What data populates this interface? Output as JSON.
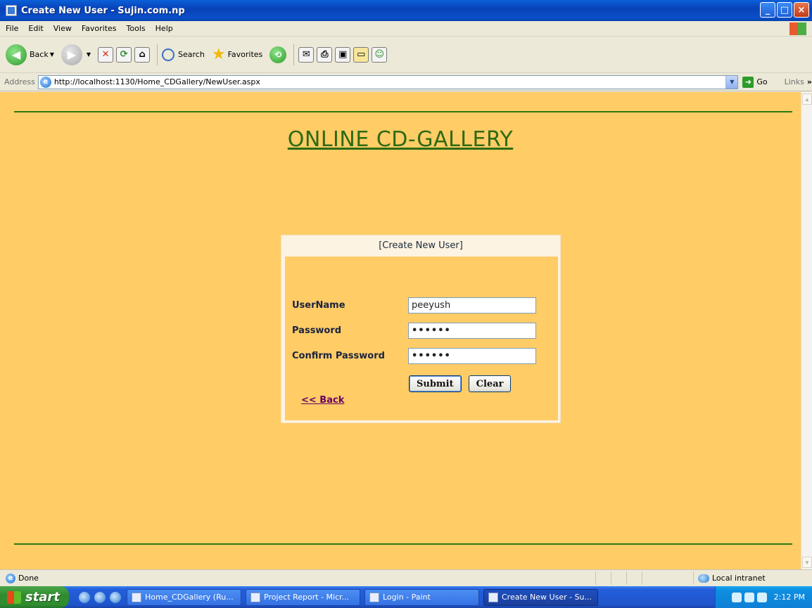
{
  "window": {
    "title": "Create New User - Sujin.com.np",
    "controls": [
      "_",
      "□",
      "×"
    ]
  },
  "menubar": {
    "items": [
      "File",
      "Edit",
      "View",
      "Favorites",
      "Tools",
      "Help"
    ]
  },
  "toolbar": {
    "back_label": "Back",
    "search_label": "Search",
    "favorites_label": "Favorites"
  },
  "addressbar": {
    "label": "Address",
    "url": "http://localhost:1130/Home_CDGallery/NewUser.aspx",
    "go_label": "Go",
    "links_label": "Links"
  },
  "page": {
    "site_title": "ONLINE CD-GALLERY",
    "panel_title": "[Create New User]",
    "fields": [
      {
        "label": "UserName",
        "value": "peeyush",
        "type": "text"
      },
      {
        "label": "Password",
        "value": "••••••",
        "type": "password"
      },
      {
        "label": "Confirm Password",
        "value": "••••••",
        "type": "password"
      }
    ],
    "submit_label": "Submit",
    "clear_label": "Clear",
    "back_link": "<< Back",
    "colors": {
      "background": "#ffcc66",
      "title": "#2d6a12",
      "rule": "#2d7a12",
      "link": "#660066"
    }
  },
  "statusbar": {
    "status": "Done",
    "zone": "Local intranet"
  },
  "taskbar": {
    "start_label": "start",
    "tasks": [
      "Home_CDGallery (Ru...",
      "Project Report - Micr...",
      "Login - Paint",
      "Create New User - Su..."
    ],
    "clock": "2:12 PM"
  }
}
